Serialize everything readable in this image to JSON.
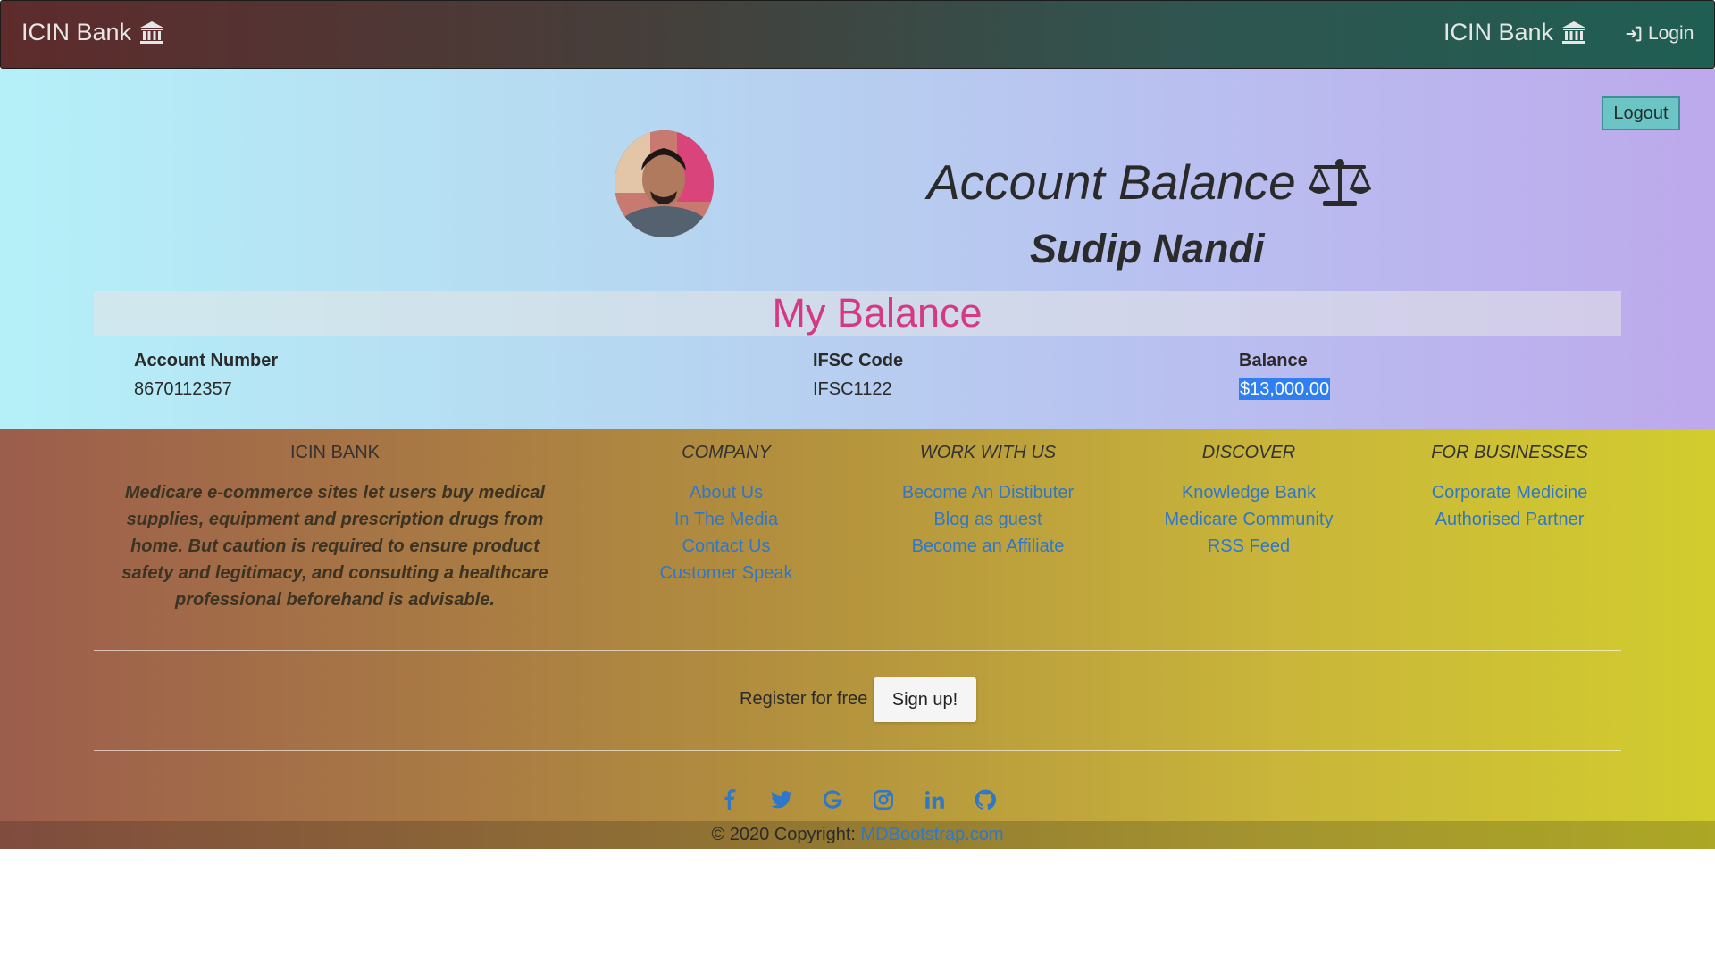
{
  "navbar": {
    "brand_left": "ICIN Bank",
    "brand_right": "ICIN Bank",
    "login_label": "Login"
  },
  "hero": {
    "logout_label": "Logout",
    "title": "Account Balance",
    "user_name": "Sudip Nandi",
    "section_title": "My Balance"
  },
  "account": {
    "account_number_label": "Account Number",
    "account_number": "8670112357",
    "ifsc_label": "IFSC Code",
    "ifsc": "IFSC1122",
    "balance_label": "Balance",
    "balance": "$13,000.00"
  },
  "footer": {
    "about": {
      "heading": "ICIN BANK",
      "text": "Medicare e-commerce sites let users buy medical supplies, equipment and prescription drugs from home. But caution is required to ensure product safety and legitimacy, and consulting a healthcare professional beforehand is advisable."
    },
    "company": {
      "heading": "COMPANY",
      "links": [
        "About Us",
        "In The Media",
        "Contact Us",
        "Customer Speak"
      ]
    },
    "work": {
      "heading": "WORK WITH US",
      "links": [
        "Become An Distibuter",
        "Blog as guest",
        "Become an Affiliate"
      ]
    },
    "discover": {
      "heading": "DISCOVER",
      "links": [
        "Knowledge Bank",
        "Medicare Community",
        "RSS Feed"
      ]
    },
    "business": {
      "heading": "FOR BUSINESSES",
      "links": [
        "Corporate Medicine",
        "Authorised Partner"
      ]
    },
    "register_text": "Register for free",
    "signup_label": "Sign up!",
    "social_icons": [
      "facebook-icon",
      "twitter-icon",
      "google-icon",
      "instagram-icon",
      "linkedin-icon",
      "github-icon"
    ],
    "copyright_text": "© 2020 Copyright: ",
    "copyright_link": "MDBootstrap.com"
  },
  "colors": {
    "section_title": "#d63984",
    "link": "#2f77c9",
    "logout_button": "#6cc4c5",
    "selection": "#2f7ff0"
  }
}
